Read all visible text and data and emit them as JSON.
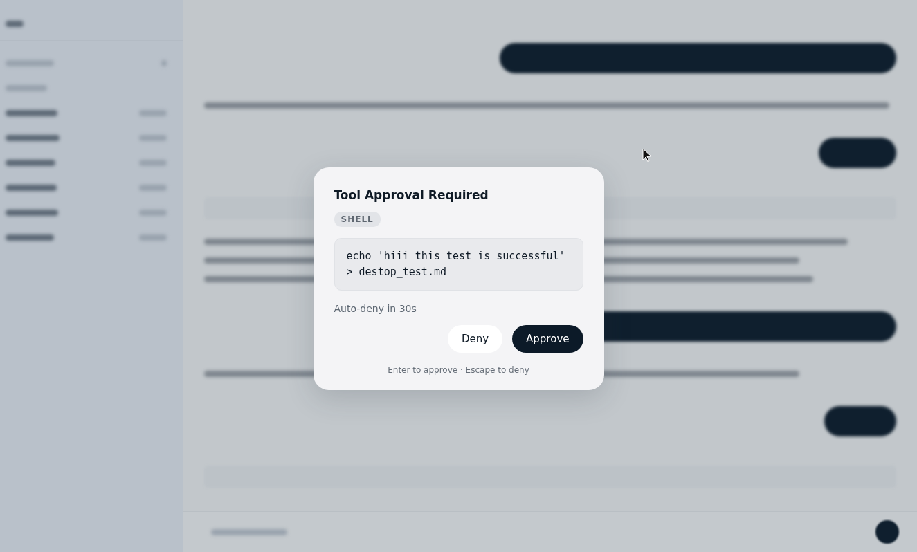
{
  "background": {
    "sidebar_rows": [
      {
        "kind": "title"
      },
      {
        "kind": "header"
      },
      {
        "kind": "loading"
      },
      {
        "kind": "session"
      },
      {
        "kind": "session"
      },
      {
        "kind": "session"
      },
      {
        "kind": "session"
      },
      {
        "kind": "session"
      },
      {
        "kind": "session"
      }
    ],
    "messages": [
      {
        "kind": "user"
      },
      {
        "kind": "assistant"
      },
      {
        "kind": "user"
      },
      {
        "kind": "tool"
      },
      {
        "kind": "assistant"
      },
      {
        "kind": "user"
      },
      {
        "kind": "assistant"
      },
      {
        "kind": "user"
      },
      {
        "kind": "tool"
      }
    ]
  },
  "dialog": {
    "title": "Tool Approval Required",
    "tool": "SHELL",
    "command": "echo 'hiii this test is successful' > destop_test.md",
    "countdown": "Auto-deny in 30s",
    "buttons": [
      {
        "label": "Deny",
        "kind": "secondary"
      },
      {
        "label": "Approve",
        "kind": "primary"
      }
    ],
    "hint": "Enter to approve · Escape to deny"
  }
}
